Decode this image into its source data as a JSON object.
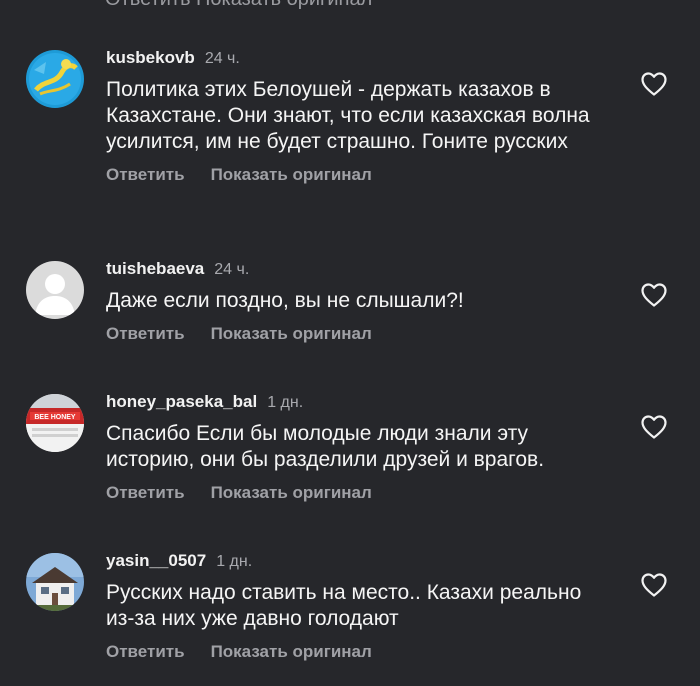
{
  "top_partial_text": "Ответить   Показать оригинал",
  "comments": [
    {
      "username": "kusbekovb",
      "time": "24 ч.",
      "text": "Политика этих Белоушей - держать казахов в Казахстане. Они знают, что если казахская волна усилится, им не будет страшно. Гоните русских",
      "reply": "Ответить",
      "show_original": "Показать оригинал",
      "avatar": "flag-avatar"
    },
    {
      "username": "tuishebaeva",
      "time": "24 ч.",
      "text": "Даже если поздно, вы не слышали?!",
      "reply": "Ответить",
      "show_original": "Показать оригинал",
      "avatar": "default-avatar"
    },
    {
      "username": "honey_paseka_bal",
      "time": "1 дн.",
      "text": "Спасибо Если бы молодые люди знали эту историю, они бы разделили друзей и врагов.",
      "reply": "Ответить",
      "show_original": "Показать оригинал",
      "avatar": "shop-sign-avatar"
    },
    {
      "username": "yasin__0507",
      "time": "1 дн.",
      "text": "Русских надо ставить на место.. Казахи реально из-за них уже давно голодают",
      "reply": "Ответить",
      "show_original": "Показать оригинал",
      "avatar": "house-avatar"
    }
  ],
  "colors": {
    "background": "#26272b",
    "text_primary": "#f2f2f2",
    "text_secondary": "#a0a1a6"
  },
  "icons": {
    "like": "heart-outline-icon"
  }
}
